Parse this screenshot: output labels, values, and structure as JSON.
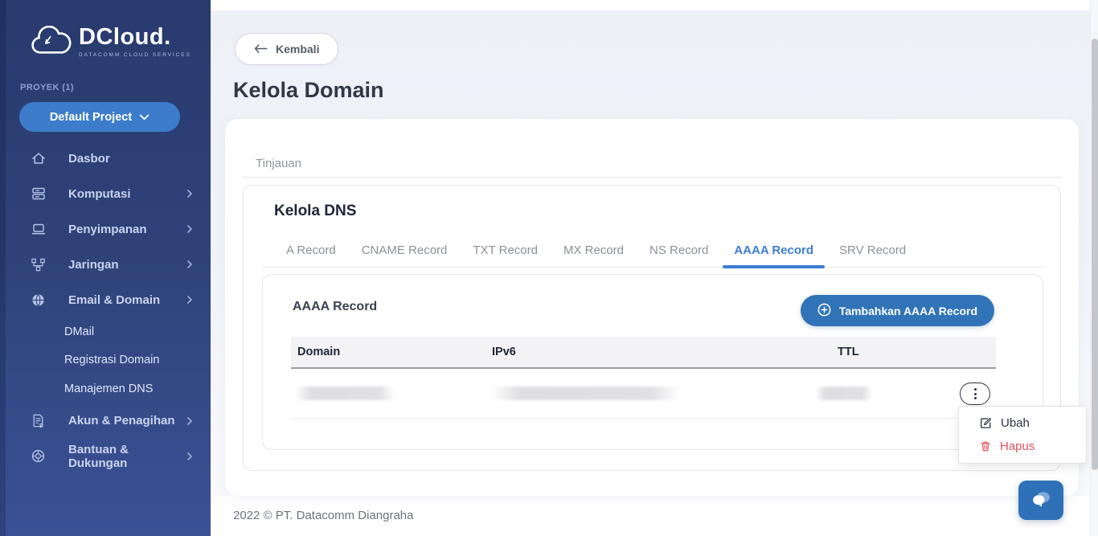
{
  "sidebar": {
    "logo": {
      "brand": "DCloud.",
      "tagline": "DATACOMM CLOUD SERVICES"
    },
    "project_label": "PROYEK (1)",
    "project_selector": "Default Project",
    "items": [
      {
        "label": "Dasbor",
        "icon": "home-icon",
        "has_children": false
      },
      {
        "label": "Komputasi",
        "icon": "compute-icon",
        "has_children": true
      },
      {
        "label": "Penyimpanan",
        "icon": "storage-icon",
        "has_children": true
      },
      {
        "label": "Jaringan",
        "icon": "network-icon",
        "has_children": true
      },
      {
        "label": "Email & Domain",
        "icon": "globe-icon",
        "has_children": true,
        "children": [
          "DMail",
          "Registrasi Domain",
          "Manajemen DNS"
        ]
      },
      {
        "label": "Akun & Penagihan",
        "icon": "billing-icon",
        "has_children": true
      },
      {
        "label": "Bantuan & Dukungan",
        "icon": "support-icon",
        "has_children": true
      }
    ]
  },
  "header": {
    "back_label": "Kembali",
    "page_title": "Kelola Domain"
  },
  "overview": {
    "tab_label": "Tinjauan"
  },
  "dns": {
    "title": "Kelola DNS",
    "tabs": [
      "A Record",
      "CNAME Record",
      "TXT Record",
      "MX Record",
      "NS Record",
      "AAAA Record",
      "SRV Record"
    ],
    "active_tab": "AAAA Record",
    "section_title": "AAAA Record",
    "add_button_label": "Tambahkan AAAA Record",
    "table": {
      "columns": [
        "Domain",
        "IPv6",
        "TTL"
      ],
      "rows": [
        {
          "domain": "",
          "ipv6": "",
          "ttl": "",
          "redacted": true
        }
      ]
    }
  },
  "context_menu": {
    "items": [
      {
        "label": "Ubah",
        "icon": "edit-icon"
      },
      {
        "label": "Hapus",
        "icon": "trash-icon",
        "color": "#E8505B"
      }
    ]
  },
  "footer": {
    "copyright": "2022 © PT. Datacomm Diangraha"
  },
  "colors": {
    "sidebar_top": "#283A6E",
    "sidebar_bottom": "#3B5195",
    "project_pill_blue": "#3C7CCA",
    "accent_button_blue": "#3173B7",
    "active_tab_blue": "#3C7DD3",
    "chat_fab_blue": "#2E71B8",
    "danger_red": "#E8505B"
  }
}
